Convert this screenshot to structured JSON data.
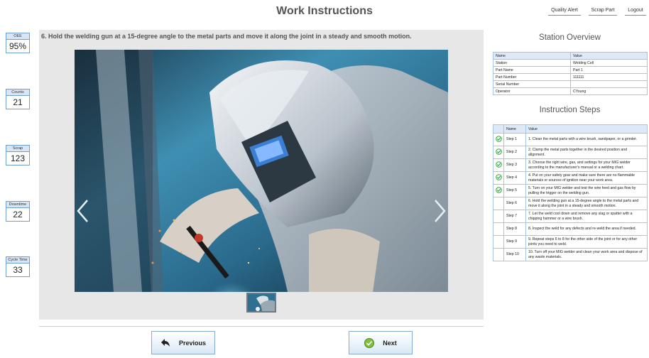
{
  "header": {
    "title": "Work Instructions",
    "quality_alert": "Quality Alert",
    "scrap_part": "Scrap Part",
    "logout": "Logout"
  },
  "metrics": [
    {
      "label": "OEE",
      "value": "95%"
    },
    {
      "label": "Counts",
      "value": "21"
    },
    {
      "label": "Scrap",
      "value": "123"
    },
    {
      "label": "Downtime",
      "value": "22"
    },
    {
      "label": "Cycle Time",
      "value": "33"
    }
  ],
  "instruction": {
    "text": "6. Hold the welding gun at a 15-degree angle to the metal parts and move it along the joint in a steady and smooth motion."
  },
  "navigation": {
    "previous": "Previous",
    "next": "Next"
  },
  "station_overview": {
    "title": "Station Overview",
    "headers": [
      "Name",
      "Value"
    ],
    "rows": [
      {
        "name": "Station",
        "value": "Welding Cell"
      },
      {
        "name": "Part Name",
        "value": "Part 1"
      },
      {
        "name": "Part Number",
        "value": "111111"
      },
      {
        "name": "Serial Number",
        "value": ""
      },
      {
        "name": "Operator",
        "value": "CYoung"
      }
    ]
  },
  "instruction_steps": {
    "title": "Instruction Steps",
    "headers": [
      "",
      "Name",
      "Value"
    ],
    "rows": [
      {
        "done": true,
        "name": "Step 1",
        "value": "1. Clean the metal parts with a wire brush, sandpaper, or a grinder."
      },
      {
        "done": true,
        "name": "Step 2",
        "value": "2. Clamp the metal parts together in the desired position and alignment."
      },
      {
        "done": true,
        "name": "Step 3",
        "value": "3. Choose the right wire, gas, and settings for your MIG welder according to the manufacturer's manual or a welding chart."
      },
      {
        "done": true,
        "name": "Step 4",
        "value": "4. Put on your safety gear and make sure there are no flammable materials or sources of ignition near your work area."
      },
      {
        "done": true,
        "name": "Step 5",
        "value": "5. Turn on your MIG welder and test the wire feed and gas flow by pulling the trigger on the welding gun."
      },
      {
        "done": false,
        "name": "Step 6",
        "value": "6. Hold the welding gun at a 15-degree angle to the metal parts and move it along the joint in a steady and smooth motion."
      },
      {
        "done": false,
        "name": "Step 7",
        "value": "7. Let the weld cool down and remove any slag or spatter with a chipping hammer or a wire brush."
      },
      {
        "done": false,
        "name": "Step 8",
        "value": "8. Inspect the weld for any defects and re-weld the area if needed."
      },
      {
        "done": false,
        "name": "Step 9",
        "value": "9. Repeat steps 6 to 8 for the other side of the joint or for any other joints you need to weld."
      },
      {
        "done": false,
        "name": "Step 10",
        "value": "10. Turn off your MIG welder and clean your work area and dispose of any waste materials."
      }
    ]
  },
  "colors": {
    "accent_border": "#6e9fd0",
    "check_green": "#2e9e3e"
  }
}
